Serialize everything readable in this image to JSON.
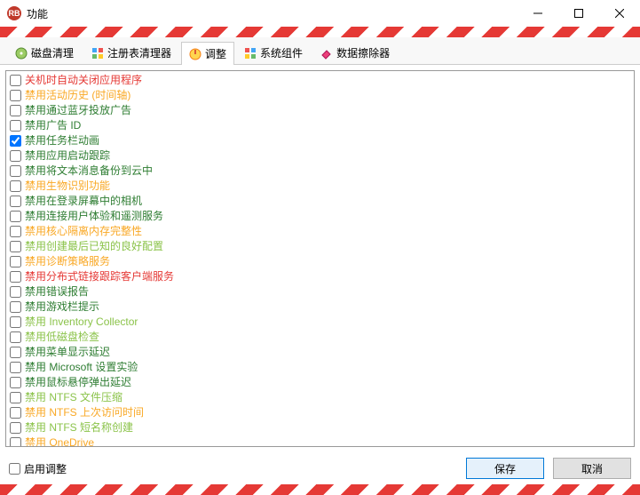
{
  "window": {
    "title": "功能",
    "icon_text": "RB"
  },
  "tabs": [
    {
      "label": "磁盘清理",
      "icon": "disk"
    },
    {
      "label": "注册表清理器",
      "icon": "registry"
    },
    {
      "label": "调整",
      "icon": "tune",
      "active": true
    },
    {
      "label": "系统组件",
      "icon": "components"
    },
    {
      "label": "数据擦除器",
      "icon": "eraser"
    }
  ],
  "items": [
    {
      "label": "关机时自动关闭应用程序",
      "color": "red",
      "checked": false
    },
    {
      "label": "禁用活动历史 (时间轴)",
      "color": "orange",
      "checked": false
    },
    {
      "label": "禁用通过蓝牙投放广告",
      "color": "green",
      "checked": false
    },
    {
      "label": "禁用广告 ID",
      "color": "green",
      "checked": false
    },
    {
      "label": "禁用任务栏动画",
      "color": "green",
      "checked": true
    },
    {
      "label": "禁用应用启动跟踪",
      "color": "green",
      "checked": false
    },
    {
      "label": "禁用将文本消息备份到云中",
      "color": "green",
      "checked": false
    },
    {
      "label": "禁用生物识别功能",
      "color": "orange",
      "checked": false
    },
    {
      "label": "禁用在登录屏幕中的相机",
      "color": "green",
      "checked": false
    },
    {
      "label": "禁用连接用户体验和遥测服务",
      "color": "green",
      "checked": false
    },
    {
      "label": "禁用核心隔离内存完整性",
      "color": "orange",
      "checked": false
    },
    {
      "label": "禁用创建最后已知的良好配置",
      "color": "lime",
      "checked": false
    },
    {
      "label": "禁用诊断策略服务",
      "color": "orange",
      "checked": false
    },
    {
      "label": "禁用分布式链接跟踪客户端服务",
      "color": "red",
      "checked": false
    },
    {
      "label": "禁用错误报告",
      "color": "green",
      "checked": false
    },
    {
      "label": "禁用游戏栏提示",
      "color": "green",
      "checked": false
    },
    {
      "label": "禁用 Inventory Collector",
      "color": "lime",
      "checked": false
    },
    {
      "label": "禁用低磁盘检查",
      "color": "lime",
      "checked": false
    },
    {
      "label": "禁用菜单显示延迟",
      "color": "green",
      "checked": false
    },
    {
      "label": "禁用 Microsoft 设置实验",
      "color": "green",
      "checked": false
    },
    {
      "label": "禁用鼠标悬停弹出延迟",
      "color": "green",
      "checked": false
    },
    {
      "label": "禁用 NTFS 文件压缩",
      "color": "lime",
      "checked": false
    },
    {
      "label": "禁用 NTFS 上次访问时间",
      "color": "orange",
      "checked": false
    },
    {
      "label": "禁用 NTFS 短名称创建",
      "color": "lime",
      "checked": false
    },
    {
      "label": "禁用 OneDrive",
      "color": "orange",
      "checked": false
    }
  ],
  "bottom": {
    "enable_label": "启用调整",
    "save": "保存",
    "cancel": "取消"
  }
}
